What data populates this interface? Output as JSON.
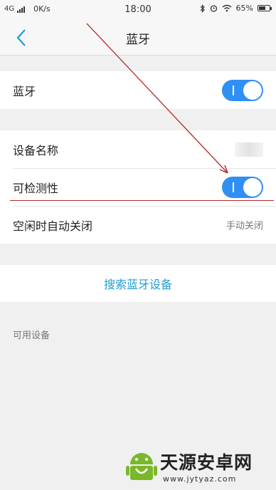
{
  "status_bar": {
    "network": "4G",
    "speed": "0K/s",
    "time": "18:00",
    "battery": "65%",
    "battery_level": 0.65
  },
  "nav": {
    "title": "蓝牙",
    "back_icon": "chevron-left-icon"
  },
  "bluetooth_row": {
    "label": "蓝牙",
    "toggle_on": true
  },
  "device_name_row": {
    "label": "设备名称"
  },
  "discoverable_row": {
    "label": "可检测性",
    "toggle_on": true
  },
  "auto_off_row": {
    "label": "空闲时自动关闭",
    "value": "手动关闭"
  },
  "search_button": {
    "label": "搜索蓝牙设备"
  },
  "available_header": "可用设备",
  "watermark": {
    "name": "天源安卓网",
    "url": "www.jytyaz.com"
  },
  "colors": {
    "accent": "#2f8ff3",
    "link": "#1e9fd0",
    "annotation": "#b42b2b"
  }
}
